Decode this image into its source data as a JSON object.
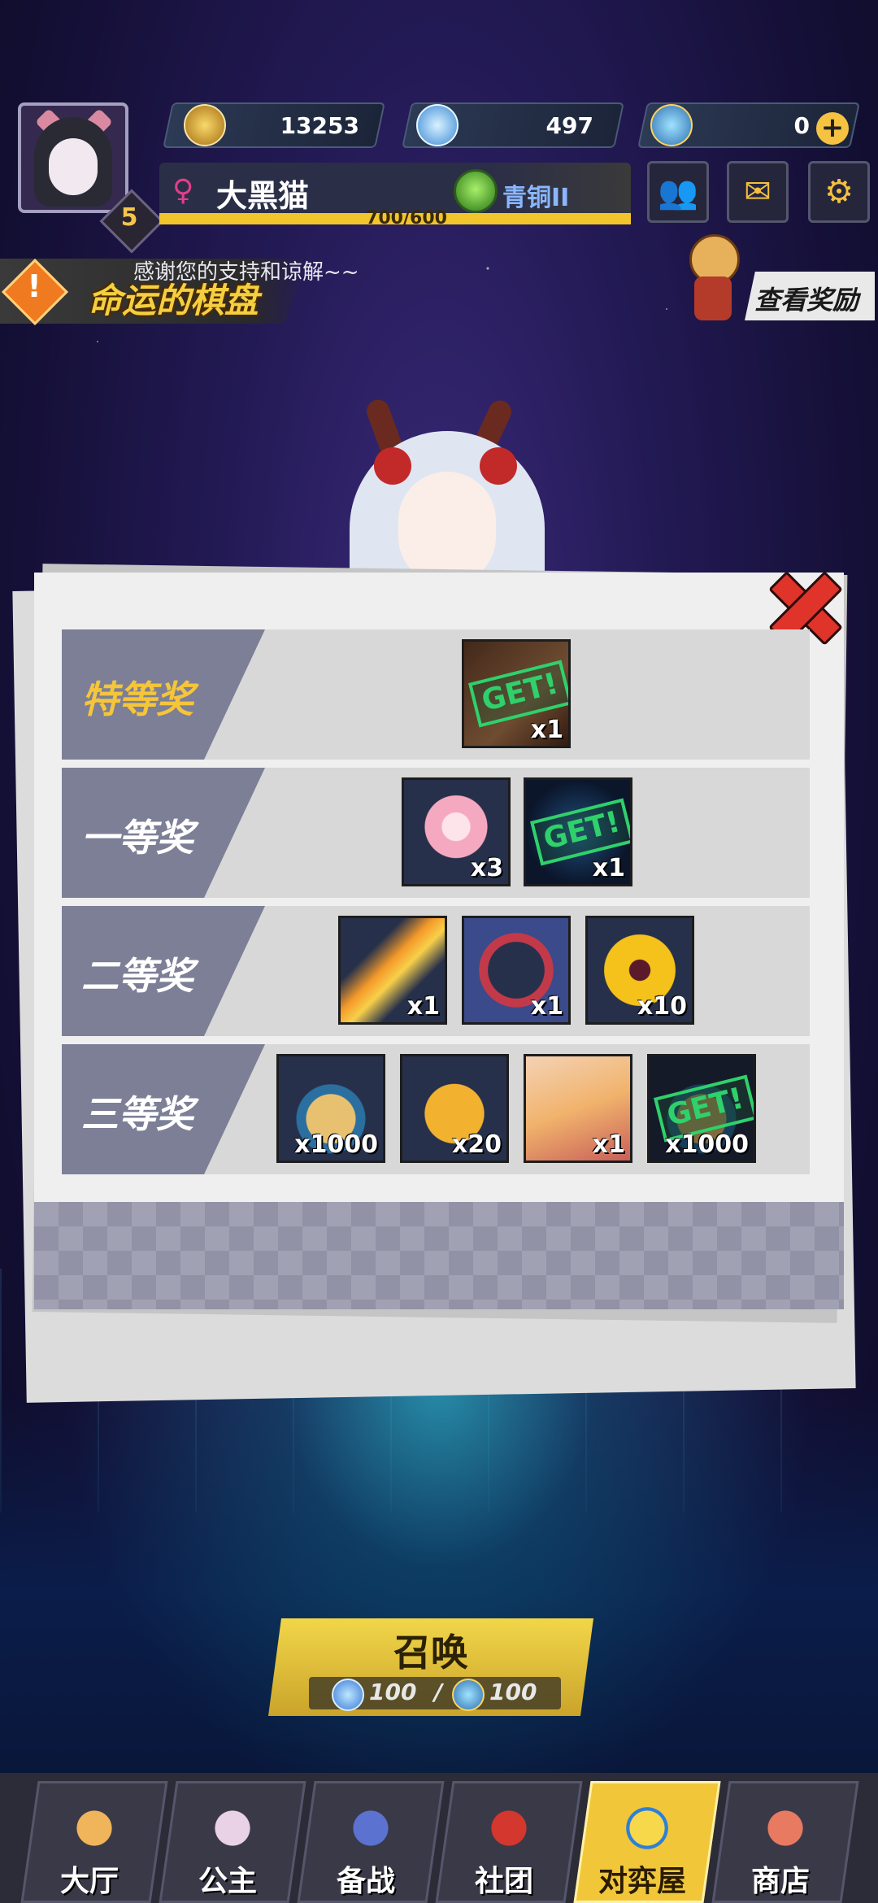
{
  "player": {
    "level": "5",
    "name": "大黑猫",
    "rank": "青铜II",
    "exp_text": "700/600",
    "exp_fraction": 1.0
  },
  "resources": [
    {
      "name": "gold-coin",
      "value": "13253"
    },
    {
      "name": "diamond",
      "value": "497"
    },
    {
      "name": "summon-ticket",
      "value": "0"
    }
  ],
  "notice": {
    "message": "感谢您的支持和谅解~~",
    "event_title": "命运的棋盘",
    "reward_button": "查看奖励"
  },
  "prize_tiers": [
    {
      "label": "特等奖",
      "items": [
        {
          "name": "character-portrait",
          "qty": "x1",
          "claimed": true
        }
      ]
    },
    {
      "label": "一等奖",
      "items": [
        {
          "name": "sakura-flower",
          "qty": "x3",
          "claimed": false
        },
        {
          "name": "blue-crystal",
          "qty": "x1",
          "claimed": true
        }
      ]
    },
    {
      "label": "二等奖",
      "items": [
        {
          "name": "flame-feather",
          "qty": "x1",
          "claimed": false
        },
        {
          "name": "avatar-frame",
          "qty": "x1",
          "claimed": false
        },
        {
          "name": "yellow-pansy",
          "qty": "x10",
          "claimed": false
        }
      ]
    },
    {
      "label": "三等奖",
      "items": [
        {
          "name": "coin-bucket",
          "qty": "x1000",
          "claimed": false
        },
        {
          "name": "lucky-bag",
          "qty": "x20",
          "claimed": false
        },
        {
          "name": "character-portrait",
          "qty": "x1",
          "claimed": false
        },
        {
          "name": "coin-bucket",
          "qty": "x1000",
          "claimed": true
        }
      ]
    }
  ],
  "get_stamp": "GET!",
  "summon": {
    "title": "召唤",
    "cost_1": "100",
    "separator": "/",
    "cost_2": "100"
  },
  "nav": [
    {
      "label": "大厅",
      "icon": "swords-icon",
      "active": false
    },
    {
      "label": "公主",
      "icon": "princess-icon",
      "active": false
    },
    {
      "label": "备战",
      "icon": "chess-icon",
      "active": false
    },
    {
      "label": "社团",
      "icon": "castle-icon",
      "active": false
    },
    {
      "label": "对弈屋",
      "icon": "chess-knight-icon",
      "active": true
    },
    {
      "label": "商店",
      "icon": "shop-icon",
      "active": false
    }
  ],
  "colors": {
    "accent_gold": "#f5c53a",
    "get_green": "#2fd16b",
    "close_red": "#e0332a"
  }
}
